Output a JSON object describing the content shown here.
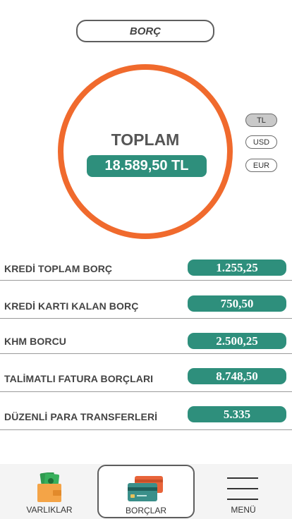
{
  "header": {
    "title": "BORÇ"
  },
  "summary": {
    "title": "TOPLAM",
    "amount": "18.589,50 TL"
  },
  "currencies": [
    {
      "label": "TL",
      "active": true
    },
    {
      "label": "USD",
      "active": false
    },
    {
      "label": "EUR",
      "active": false
    }
  ],
  "debts": [
    {
      "label": "KREDİ TOPLAM BORÇ",
      "value": "1.255,25"
    },
    {
      "label": "KREDİ KARTI KALAN BORÇ",
      "value": "750,50"
    },
    {
      "label": "KHM BORCU",
      "value": "2.500,25"
    },
    {
      "label": "TALİMATLI FATURA BORÇLARI",
      "value": "8.748,50"
    },
    {
      "label": "DÜZENLİ PARA TRANSFERLERİ",
      "value": "5.335"
    }
  ],
  "nav": {
    "items": [
      {
        "label": "VARLIKLAR",
        "icon": "wallet-icon"
      },
      {
        "label": "BORÇLAR",
        "icon": "credit-card-icon",
        "active": true
      },
      {
        "label": "MENÜ",
        "icon": "hamburger-menu-icon"
      }
    ]
  },
  "colors": {
    "accent_orange": "#f06a2d",
    "teal": "#2e8f7c"
  }
}
